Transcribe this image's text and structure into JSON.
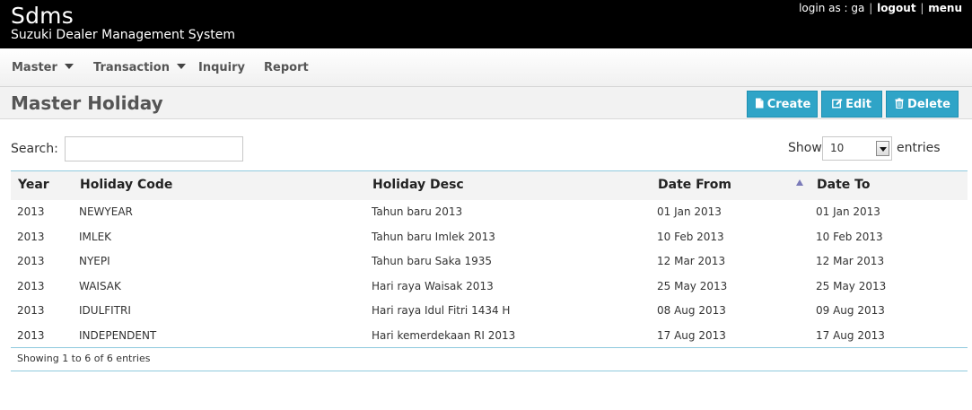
{
  "header": {
    "brand": "Sdms",
    "tagline": "Suzuki Dealer Management System",
    "login_text": "login as : ga",
    "separator": "|",
    "logout": "logout",
    "menu": "menu"
  },
  "nav": [
    {
      "label": "Master",
      "dropdown": true
    },
    {
      "label": "Transaction",
      "dropdown": true
    },
    {
      "label": "Inquiry",
      "dropdown": false
    },
    {
      "label": "Report",
      "dropdown": false
    }
  ],
  "page": {
    "title": "Master Holiday",
    "buttons": {
      "create": "Create",
      "edit": "Edit",
      "delete": "Delete"
    },
    "accent_color": "#2fa4c7"
  },
  "table_controls": {
    "search_label": "Search:",
    "search_value": "",
    "show_label": "Show",
    "show_value": "10",
    "entries_label": "entries"
  },
  "table": {
    "columns": [
      "Year",
      "Holiday Code",
      "Holiday Desc",
      "Date From",
      "Date To"
    ],
    "sorted_column": "Date From",
    "sort_direction": "ascending",
    "rows": [
      [
        "2013",
        "NEWYEAR",
        "Tahun baru 2013",
        "01 Jan 2013",
        "01 Jan 2013"
      ],
      [
        "2013",
        "IMLEK",
        "Tahun baru Imlek 2013",
        "10 Feb 2013",
        "10 Feb 2013"
      ],
      [
        "2013",
        "NYEPI",
        "Tahun baru Saka 1935",
        "12 Mar 2013",
        "12 Mar 2013"
      ],
      [
        "2013",
        "WAISAK",
        "Hari raya Waisak 2013",
        "25 May 2013",
        "25 May 2013"
      ],
      [
        "2013",
        "IDULFITRI",
        "Hari raya Idul Fitri 1434 H",
        "08 Aug 2013",
        "09 Aug 2013"
      ],
      [
        "2013",
        "INDEPENDENT",
        "Hari kemerdekaan RI 2013",
        "17 Aug 2013",
        "17 Aug 2013"
      ]
    ],
    "info": "Showing 1 to 6 of 6 entries"
  }
}
